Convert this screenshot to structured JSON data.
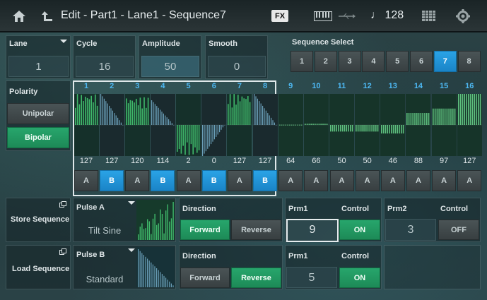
{
  "header": {
    "title": "Edit - Part1 - Lane1 - Sequence7",
    "fx_label": "FX",
    "tempo": "128",
    "tempo_icon": "note-icon"
  },
  "lane": {
    "label": "Lane",
    "value": "1"
  },
  "cycle": {
    "label": "Cycle",
    "value": "16"
  },
  "amplitude": {
    "label": "Amplitude",
    "value": "50"
  },
  "smooth": {
    "label": "Smooth",
    "value": "0"
  },
  "sequence_select": {
    "label": "Sequence Select",
    "options": [
      "1",
      "2",
      "3",
      "4",
      "5",
      "6",
      "7",
      "8"
    ],
    "selected": "7"
  },
  "polarity": {
    "label": "Polarity",
    "options": [
      "Unipolar",
      "Bipolar"
    ],
    "selected": "Bipolar"
  },
  "steps": [
    {
      "num": "1",
      "value": "127",
      "type": "A"
    },
    {
      "num": "2",
      "value": "127",
      "type": "B"
    },
    {
      "num": "3",
      "value": "120",
      "type": "A"
    },
    {
      "num": "4",
      "value": "114",
      "type": "B"
    },
    {
      "num": "5",
      "value": "2",
      "type": "A"
    },
    {
      "num": "6",
      "value": "0",
      "type": "B"
    },
    {
      "num": "7",
      "value": "127",
      "type": "A"
    },
    {
      "num": "8",
      "value": "127",
      "type": "B"
    },
    {
      "num": "9",
      "value": "64",
      "type": "A"
    },
    {
      "num": "10",
      "value": "66",
      "type": "A"
    },
    {
      "num": "11",
      "value": "50",
      "type": "A"
    },
    {
      "num": "12",
      "value": "50",
      "type": "A"
    },
    {
      "num": "13",
      "value": "46",
      "type": "A"
    },
    {
      "num": "14",
      "value": "88",
      "type": "A"
    },
    {
      "num": "15",
      "value": "97",
      "type": "A"
    },
    {
      "num": "16",
      "value": "127",
      "type": "A"
    }
  ],
  "store_sequence": {
    "label": "Store Sequence"
  },
  "load_sequence": {
    "label": "Load Sequence"
  },
  "pulse_a": {
    "label": "Pulse A",
    "value": "Tilt Sine",
    "direction_label": "Direction",
    "forward": "Forward",
    "reverse": "Reverse",
    "direction_selected": "Forward",
    "prm1_label": "Prm1",
    "prm1_value": "9",
    "control_label": "Control",
    "control_value": "ON",
    "prm2_label": "Prm2",
    "prm2_value": "3",
    "control2_label": "Control",
    "control2_value": "OFF"
  },
  "pulse_b": {
    "label": "Pulse B",
    "value": "Standard",
    "direction_label": "Direction",
    "forward": "Forward",
    "reverse": "Reverse",
    "direction_selected": "Reverse",
    "prm1_label": "Prm1",
    "prm1_value": "5",
    "control_label": "Control",
    "control_value": "ON"
  },
  "colors": {
    "accent_blue": "#2aa3e6",
    "accent_green": "#27a66c",
    "step_number": "#4db8f2"
  }
}
